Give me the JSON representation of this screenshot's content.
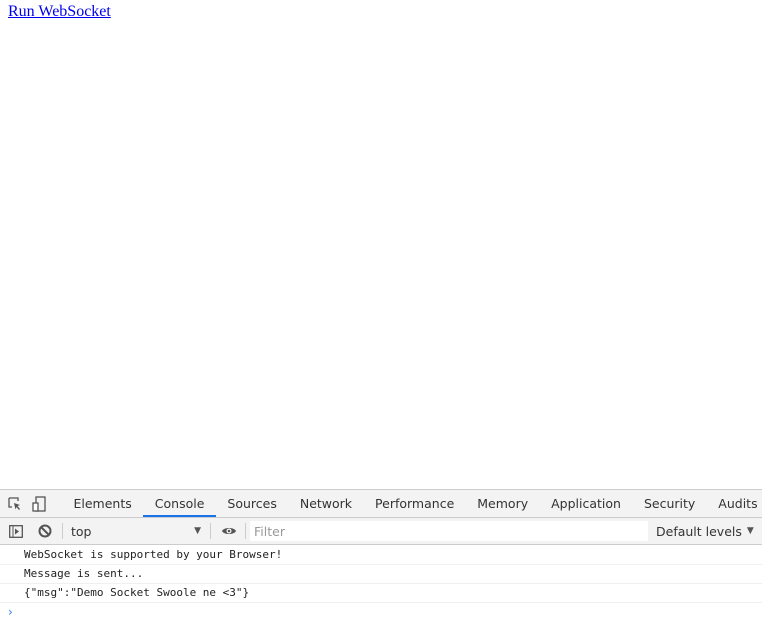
{
  "page": {
    "link": "Run WebSocket"
  },
  "devtools": {
    "tabs": [
      "Elements",
      "Console",
      "Sources",
      "Network",
      "Performance",
      "Memory",
      "Application",
      "Security",
      "Audits"
    ],
    "active_tab": "Console",
    "context": "top",
    "filter_placeholder": "Filter",
    "levels": "Default levels",
    "messages": [
      "WebSocket is supported by your Browser!",
      "Message is sent...",
      "{\"msg\":\"Demo Socket Swoole ne <3\"}"
    ],
    "prompt": "›"
  }
}
